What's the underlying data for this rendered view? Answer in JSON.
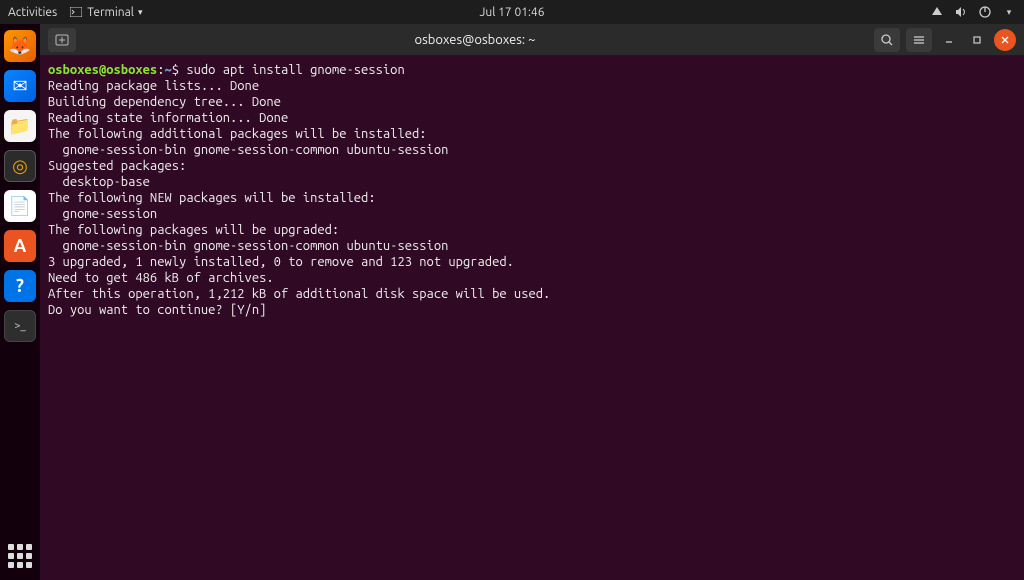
{
  "topbar": {
    "activities": "Activities",
    "app_label": "Terminal",
    "datetime": "Jul 17  01:46"
  },
  "dock": {
    "items": [
      {
        "name": "firefox",
        "glyph": "🦊"
      },
      {
        "name": "thunderbird",
        "glyph": "✉"
      },
      {
        "name": "files",
        "glyph": "📁"
      },
      {
        "name": "rhythmbox",
        "glyph": "◎"
      },
      {
        "name": "libreoffice",
        "glyph": "📄"
      },
      {
        "name": "software",
        "glyph": "A"
      },
      {
        "name": "help",
        "glyph": "?"
      },
      {
        "name": "terminal",
        "glyph": ">_"
      }
    ]
  },
  "terminal": {
    "title": "osboxes@osboxes: ~",
    "prompt_user": "osboxes@osboxes",
    "prompt_path": "~",
    "prompt_symbol": "$",
    "command": "sudo apt install gnome-session",
    "output_lines": [
      "Reading package lists... Done",
      "Building dependency tree... Done",
      "Reading state information... Done",
      "The following additional packages will be installed:",
      "  gnome-session-bin gnome-session-common ubuntu-session",
      "Suggested packages:",
      "  desktop-base",
      "The following NEW packages will be installed:",
      "  gnome-session",
      "The following packages will be upgraded:",
      "  gnome-session-bin gnome-session-common ubuntu-session",
      "3 upgraded, 1 newly installed, 0 to remove and 123 not upgraded.",
      "Need to get 486 kB of archives.",
      "After this operation, 1,212 kB of additional disk space will be used.",
      "Do you want to continue? [Y/n]"
    ]
  }
}
